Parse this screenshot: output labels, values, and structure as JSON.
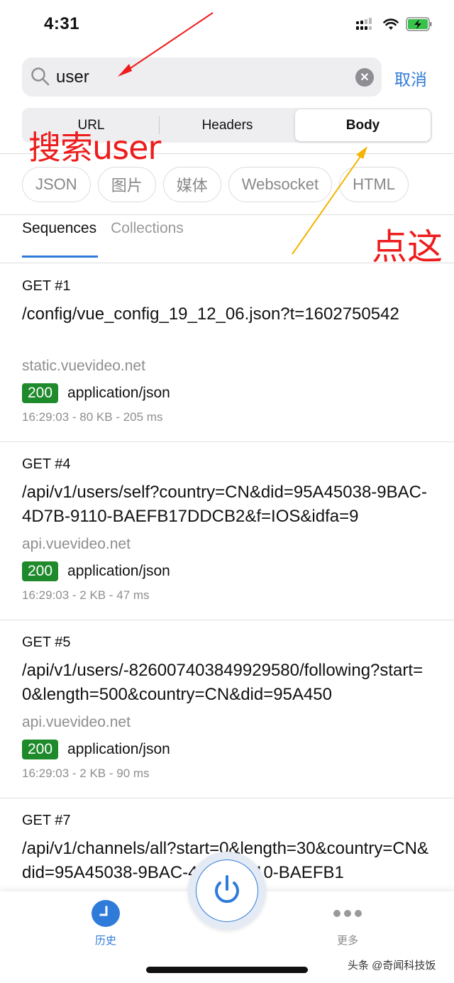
{
  "status_bar": {
    "time": "4:31",
    "icons": [
      "cellular-signal-icon",
      "wifi-icon",
      "battery-charging-icon"
    ]
  },
  "search": {
    "value": "user",
    "placeholder": "",
    "cancel_label": "取消",
    "icon": "search-icon",
    "clear_icon": "clear-icon"
  },
  "segmented_control": {
    "segments": [
      {
        "label": "URL",
        "active": false
      },
      {
        "label": "Headers",
        "active": false
      },
      {
        "label": "Body",
        "active": true
      }
    ]
  },
  "filters": [
    {
      "label": "JSON"
    },
    {
      "label": "图片"
    },
    {
      "label": "媒体"
    },
    {
      "label": "Websocket"
    },
    {
      "label": "HTML"
    }
  ],
  "tabs": [
    {
      "label": "Sequences",
      "active": true
    },
    {
      "label": "Collections",
      "active": false
    }
  ],
  "requests": [
    {
      "method_line": "GET  #1",
      "url": "/config/vue_config_19_12_06.json?t=1602750542",
      "host": "static.vuevideo.net",
      "status": "200",
      "content_type": "application/json",
      "meta": "16:29:03 - 80 KB - 205 ms"
    },
    {
      "method_line": "GET  #4",
      "url": "/api/v1/users/self?country=CN&did=95A45038-9BAC-4D7B-9110-BAEFB17DDCB2&f=IOS&idfa=9",
      "host": "api.vuevideo.net",
      "status": "200",
      "content_type": "application/json",
      "meta": "16:29:03 - 2 KB - 47 ms"
    },
    {
      "method_line": "GET  #5",
      "url": "/api/v1/users/-8260074038499295​80/following?start=0&length=500&country=CN&did=95A450",
      "host": "api.vuevideo.net",
      "status": "200",
      "content_type": "application/json",
      "meta": "16:29:03 - 2 KB - 90 ms"
    },
    {
      "method_line": "GET  #7",
      "url": "/api/v1/channels/all?start=0&length=30&country=CN&did=95A45038-9BAC-4D7B-9110-BAEFB1",
      "host": "",
      "status": "",
      "content_type": "",
      "meta": ""
    }
  ],
  "tabbar": {
    "history_label": "历史",
    "more_label": "更多",
    "power_icon": "power-icon"
  },
  "annotations": {
    "search_note": "搜索user",
    "click_note": "点这"
  },
  "watermark": "头条 @奇闻科技饭",
  "colors": {
    "accent": "#2f7bd9",
    "status_ok": "#1f8a2c",
    "annotation_red": "#ee1c1c",
    "annotation_yellow": "#f5b400"
  }
}
